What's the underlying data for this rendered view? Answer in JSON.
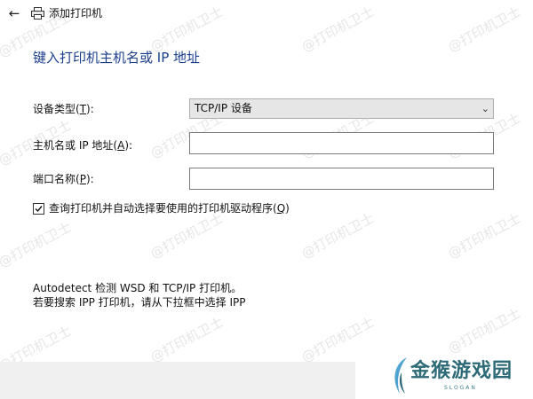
{
  "window": {
    "back_icon": "back-arrow-icon",
    "printer_icon": "printer-icon",
    "title": "添加打印机"
  },
  "page": {
    "heading": "键入打印机主机名或 IP 地址"
  },
  "form": {
    "device_type": {
      "label": "设备类型",
      "accesskey": "T",
      "value": "TCP/IP 设备"
    },
    "hostname": {
      "label": "主机名或 IP 地址",
      "accesskey": "A",
      "value": ""
    },
    "port_name": {
      "label": "端口名称",
      "accesskey": "P",
      "value": ""
    },
    "query_printer": {
      "label": "查询打印机并自动选择要使用的打印机驱动程序",
      "accesskey": "Q",
      "checked": true
    }
  },
  "info": {
    "line1": "Autodetect 检测 WSD 和 TCP/IP 打印机。",
    "line2": "若要搜索 IPP 打印机，请从下拉框中选择 IPP"
  },
  "watermark": {
    "text": "@打印机卫士"
  },
  "logo": {
    "text": "金猴游戏园",
    "slogan": "SLOGAN"
  },
  "colors": {
    "heading": "#1c3f8c",
    "logo": "#2c6a78"
  }
}
